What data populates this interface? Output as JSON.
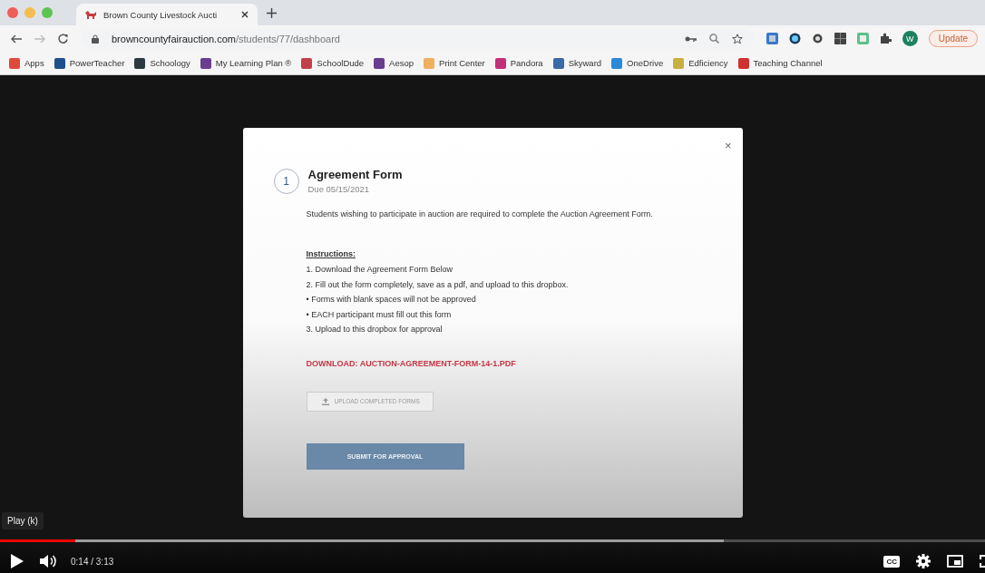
{
  "browser": {
    "tab": {
      "title": "Brown County Livestock Aucti",
      "selected": true
    },
    "url": {
      "domain": "browncountyfairauction.com",
      "path": "/students/77/dashboard"
    },
    "update_button": "Update",
    "profile_initial": "W",
    "bookmarks": [
      {
        "label": "Apps",
        "color": "#e04a3a"
      },
      {
        "label": "PowerTeacher",
        "color": "#1f4e8c"
      },
      {
        "label": "Schoology",
        "color": "#2c3a40"
      },
      {
        "label": "My Learning Plan ®",
        "color": "#6a3e8f"
      },
      {
        "label": "SchoolDude",
        "color": "#c2404a"
      },
      {
        "label": "Aesop",
        "color": "#6a3e8f"
      },
      {
        "label": "Print Center",
        "color": "#f0b060"
      },
      {
        "label": "Pandora",
        "color": "#c2307a"
      },
      {
        "label": "Skyward",
        "color": "#3a6aa8"
      },
      {
        "label": "OneDrive",
        "color": "#2a8ad8"
      },
      {
        "label": "Edficiency",
        "color": "#c8b040"
      },
      {
        "label": "Teaching Channel",
        "color": "#d03030"
      }
    ]
  },
  "modal": {
    "step": "1",
    "title": "Agreement Form",
    "due": "Due 05/15/2021",
    "description": "Students wishing to participate in auction are required to complete the Auction Agreement Form.",
    "instructions_heading": "Instructions:",
    "instructions": [
      "1. Download the Agreement Form Below",
      "2. Fill out the form completely, save as a pdf, and upload to this dropbox.",
      "• Forms with blank spaces will not be approved",
      "• EACH participant must fill out this form",
      "3. Upload to this dropbox for approval"
    ],
    "download_link": "DOWNLOAD: AUCTION-AGREEMENT-FORM-14-1.PDF",
    "upload_button": "UPLOAD COMPLETED FORMS",
    "submit_button": "SUBMIT FOR APPROVAL",
    "close": "×"
  },
  "player": {
    "tooltip": "Play (k)",
    "progress": {
      "level": 0.076
    },
    "time": "0:14 / 3:13",
    "cc": "CC"
  }
}
